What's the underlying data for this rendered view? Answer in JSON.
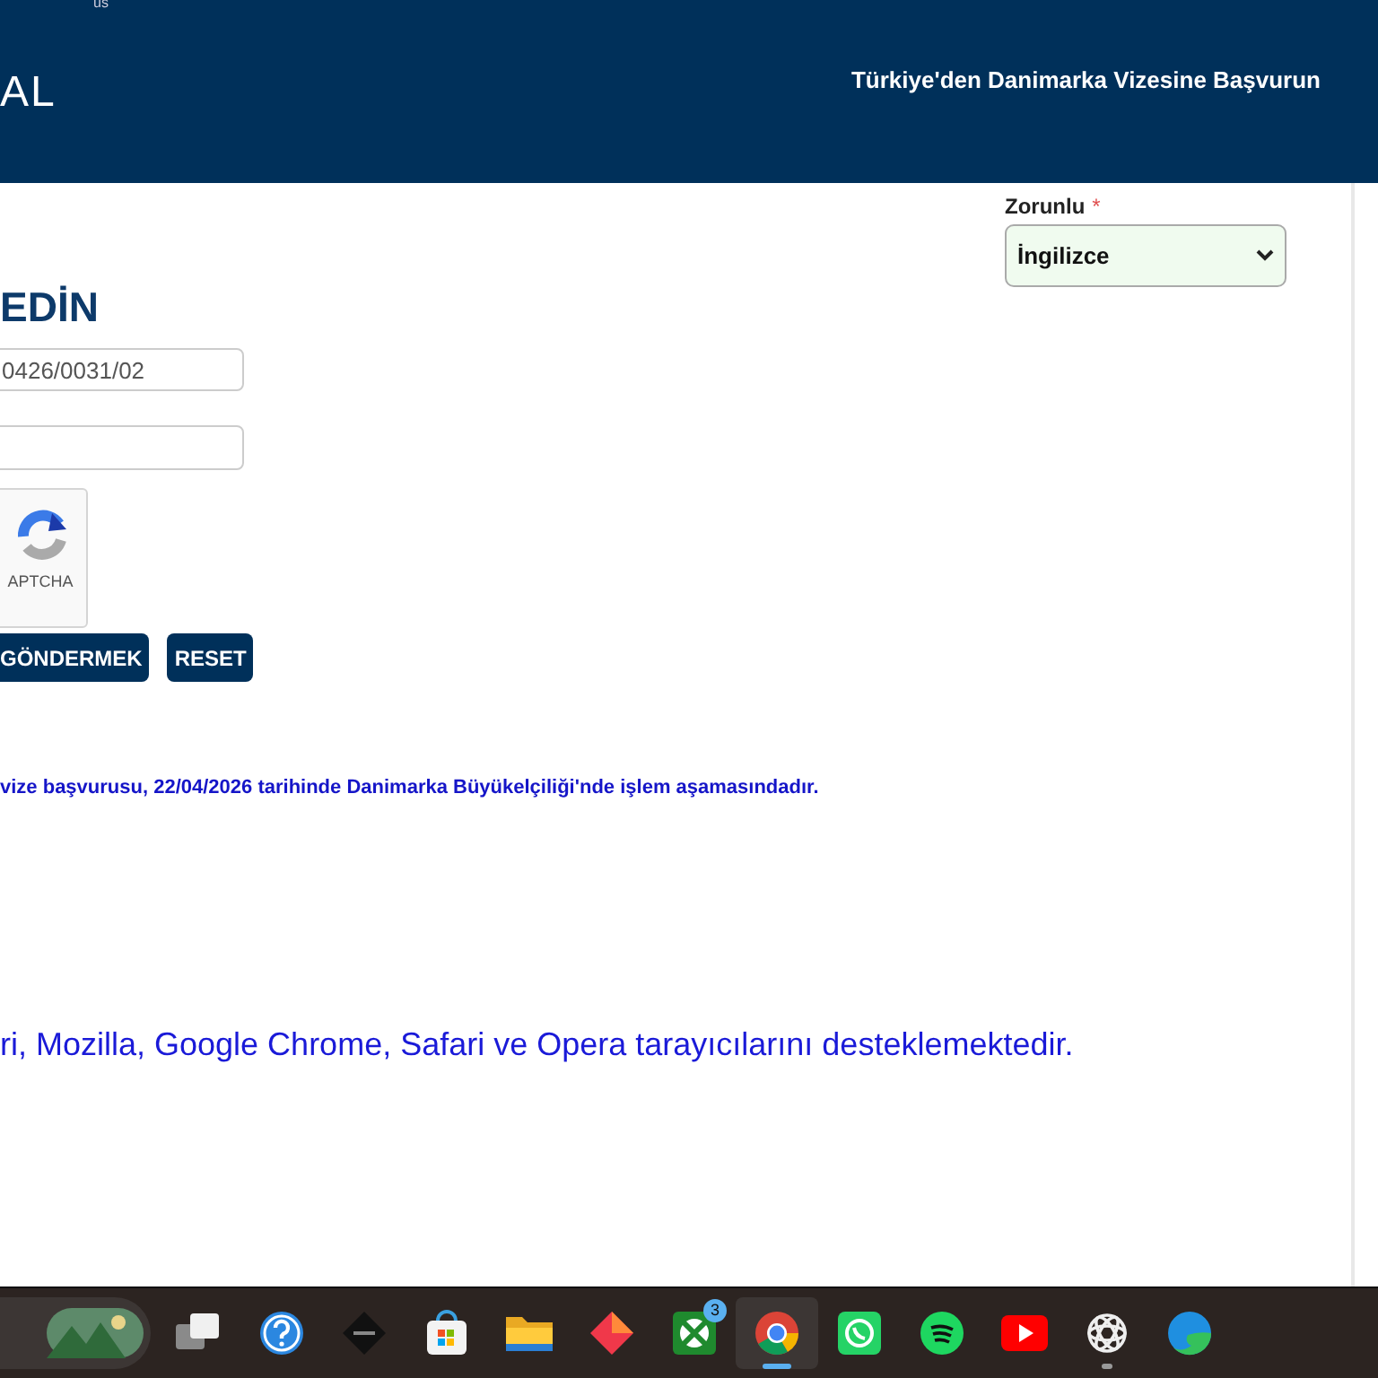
{
  "header": {
    "top_text": "us",
    "logo_text": "AL",
    "title": "Türkiye'den Danimarka Vizesine Başvurun"
  },
  "language": {
    "label": "Zorunlu",
    "required_mark": "*",
    "value": "İngilizce"
  },
  "form": {
    "heading": "EDİN",
    "reference_value": "0426/0031/02",
    "captcha_label": "APTCHA",
    "buttons": [
      "GÖNDERMEK",
      "RESET"
    ]
  },
  "status_message": "vize başvurusu, 22/04/2026 tarihinde Danimarka Büyükelçiliği'nde işlem aşamasındadır.",
  "browser_note": "ri, Mozilla, Google Chrome, Safari ve Opera tarayıcılarını desteklemektedir.",
  "taskbar": {
    "apps": [
      {
        "kind": "widget",
        "active": false
      },
      {
        "kind": "task-view",
        "active": false
      },
      {
        "kind": "help",
        "active": false
      },
      {
        "kind": "omen",
        "active": false
      },
      {
        "kind": "store",
        "active": false
      },
      {
        "kind": "folder",
        "active": false
      },
      {
        "kind": "diamond",
        "active": false
      },
      {
        "kind": "xbox",
        "active": false,
        "badge": "3"
      },
      {
        "kind": "chrome",
        "active": true
      },
      {
        "kind": "whatsapp",
        "active": false
      },
      {
        "kind": "spotify",
        "active": false
      },
      {
        "kind": "youtube",
        "active": false
      },
      {
        "kind": "openai",
        "active": false,
        "running": true
      },
      {
        "kind": "edge",
        "active": false
      }
    ]
  }
}
